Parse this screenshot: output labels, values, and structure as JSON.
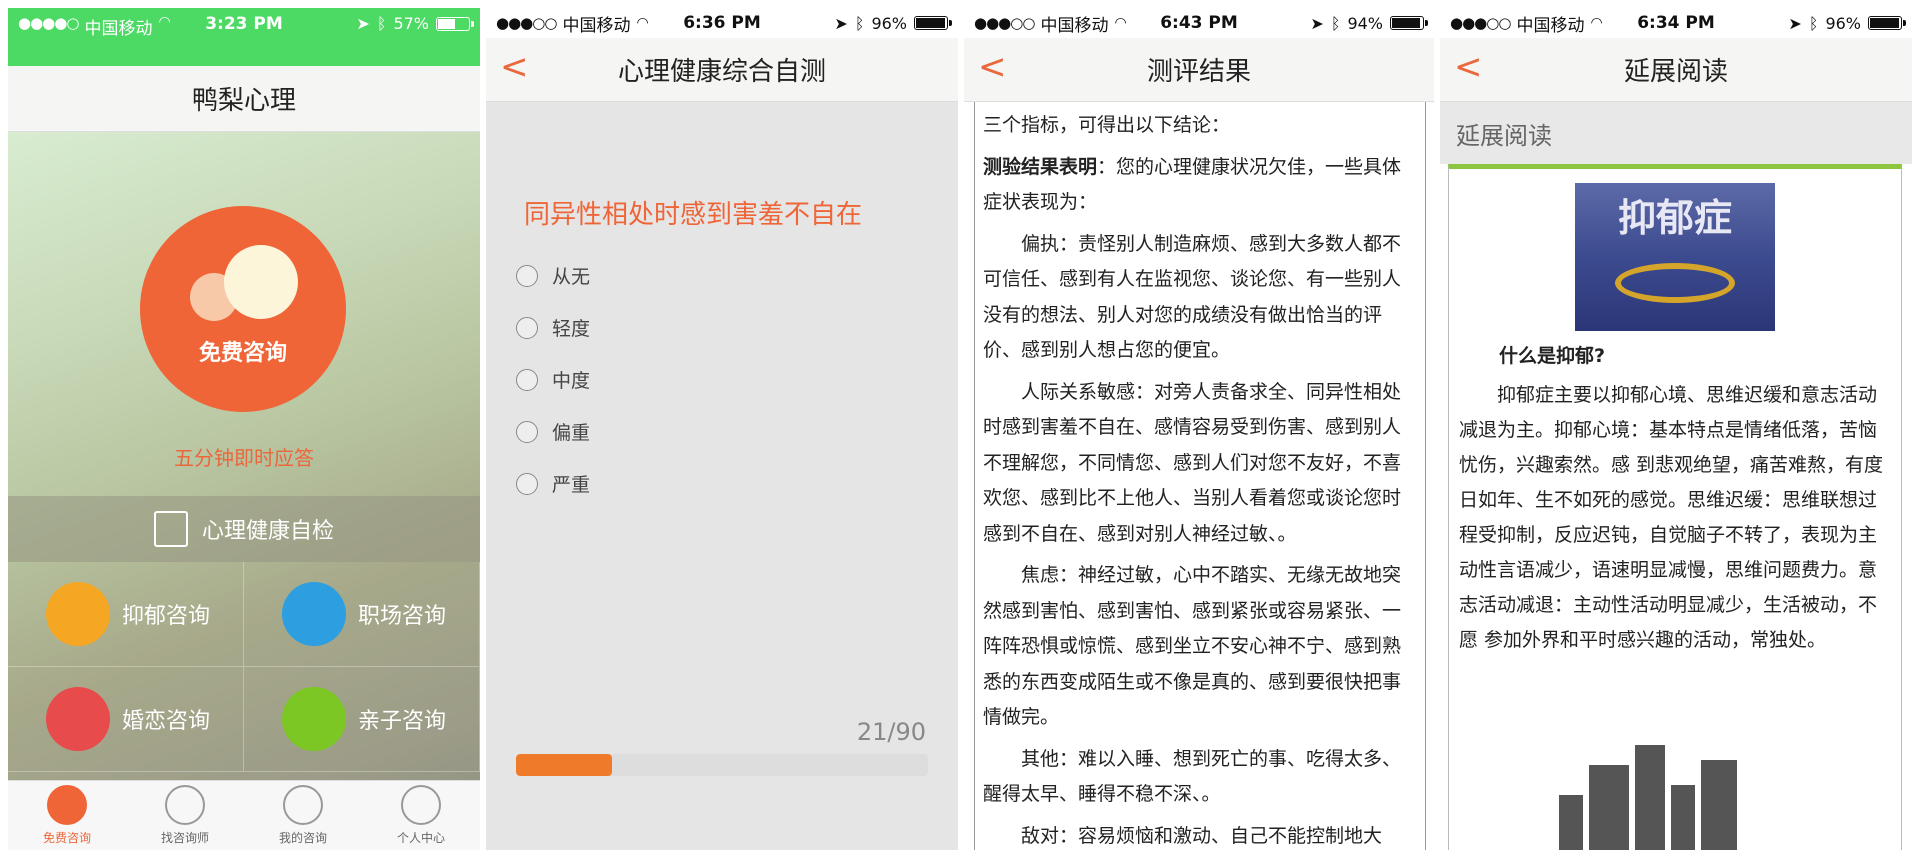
{
  "screens": [
    {
      "status": {
        "signal": "●●●●○",
        "carrier": "中国移动",
        "time": "3:23 PM",
        "battery": "57%"
      },
      "title": "鸭梨心理",
      "hero_button": "免费咨询",
      "hero_sub": "五分钟即时应答",
      "self_check": "心理健康自检",
      "categories": [
        {
          "label": "抑郁咨询",
          "color": "#f5a623",
          "icon": "heart-icon"
        },
        {
          "label": "职场咨询",
          "color": "#2d9ee0",
          "icon": "briefcase-icon"
        },
        {
          "label": "婚恋咨询",
          "color": "#e84b4b",
          "icon": "chat-icon"
        },
        {
          "label": "亲子咨询",
          "color": "#7cc723",
          "icon": "bag-icon"
        }
      ],
      "tabs": [
        {
          "label": "免费咨询",
          "icon": "chat-bubble-icon",
          "active": true
        },
        {
          "label": "找咨询师",
          "icon": "search-icon",
          "active": false
        },
        {
          "label": "我的咨询",
          "icon": "clock-icon",
          "active": false
        },
        {
          "label": "个人中心",
          "icon": "person-icon",
          "active": false
        }
      ]
    },
    {
      "status": {
        "signal": "●●●○○",
        "carrier": "中国移动",
        "time": "6:36 PM",
        "battery": "96%",
        "battery_level": 0.96
      },
      "back": "<",
      "title": "心理健康综合自测",
      "question": "同异性相处时感到害羞不自在",
      "options": [
        "从无",
        "轻度",
        "中度",
        "偏重",
        "严重"
      ],
      "progress_text": "21/90",
      "progress_value": 0.2333
    },
    {
      "status": {
        "signal": "●●●○○",
        "carrier": "中国移动",
        "time": "6:43 PM",
        "battery": "94%",
        "battery_level": 0.94
      },
      "back": "<",
      "title": "测评结果",
      "line1": "三个指标，可得出以下结论：",
      "result_bold": "测验结果表明",
      "result_rest": "：您的心理健康状况欠佳，一些具体症状表现为：",
      "paragraphs": [
        "偏执：责怪别人制造麻烦、感到大多数人都不可信任、感到有人在监视您、谈论您、有一些别人没有的想法、别人对您的成绩没有做出恰当的评价、感到别人想占您的便宜。",
        "人际关系敏感：对旁人责备求全、同异性相处时感到害羞不自在、感情容易受到伤害、感到别人不理解您，不同情您、感到人们对您不友好，不喜欢您、感到比不上他人、当别人看着您或谈论您时感到不自在、感到对别人神经过敏、。",
        "焦虑：神经过敏，心中不踏实、无缘无故地突然感到害怕、感到害怕、感到紧张或容易紧张、一阵阵恐惧或惊慌、感到坐立不安心神不宁、感到熟悉的东西变成陌生或不像是真的、感到要很快把事情做完。",
        "其他：难以入睡、想到死亡的事、吃得太多、醒得太早、睡得不稳不深、。",
        "敌对：容易烦恼和激动、自己不能控制地大"
      ]
    },
    {
      "status": {
        "signal": "●●●○○",
        "carrier": "中国移动",
        "time": "6:34 PM",
        "battery": "96%",
        "battery_level": 0.96
      },
      "back": "<",
      "title": "延展阅读",
      "section": "延展阅读",
      "image_caption": "抑郁症",
      "heading": "什么是抑郁?",
      "body": "抑郁症主要以抑郁心境、思维迟缓和意志活动减退为主。抑郁心境：基本特点是情绪低落，苦恼忧伤，兴趣索然。感 到悲观绝望，痛苦难熬，有度日如年、生不如死的感觉。思维迟缓：思维联想过程受抑制，反应迟钝，自觉脑子不转了，表现为主动性言语减少，语速明显减慢，思维问题费力。意志活动减退：主动性活动明显减少，生活被动，不愿 参加外界和平时感兴趣的活动，常独处。"
    }
  ]
}
